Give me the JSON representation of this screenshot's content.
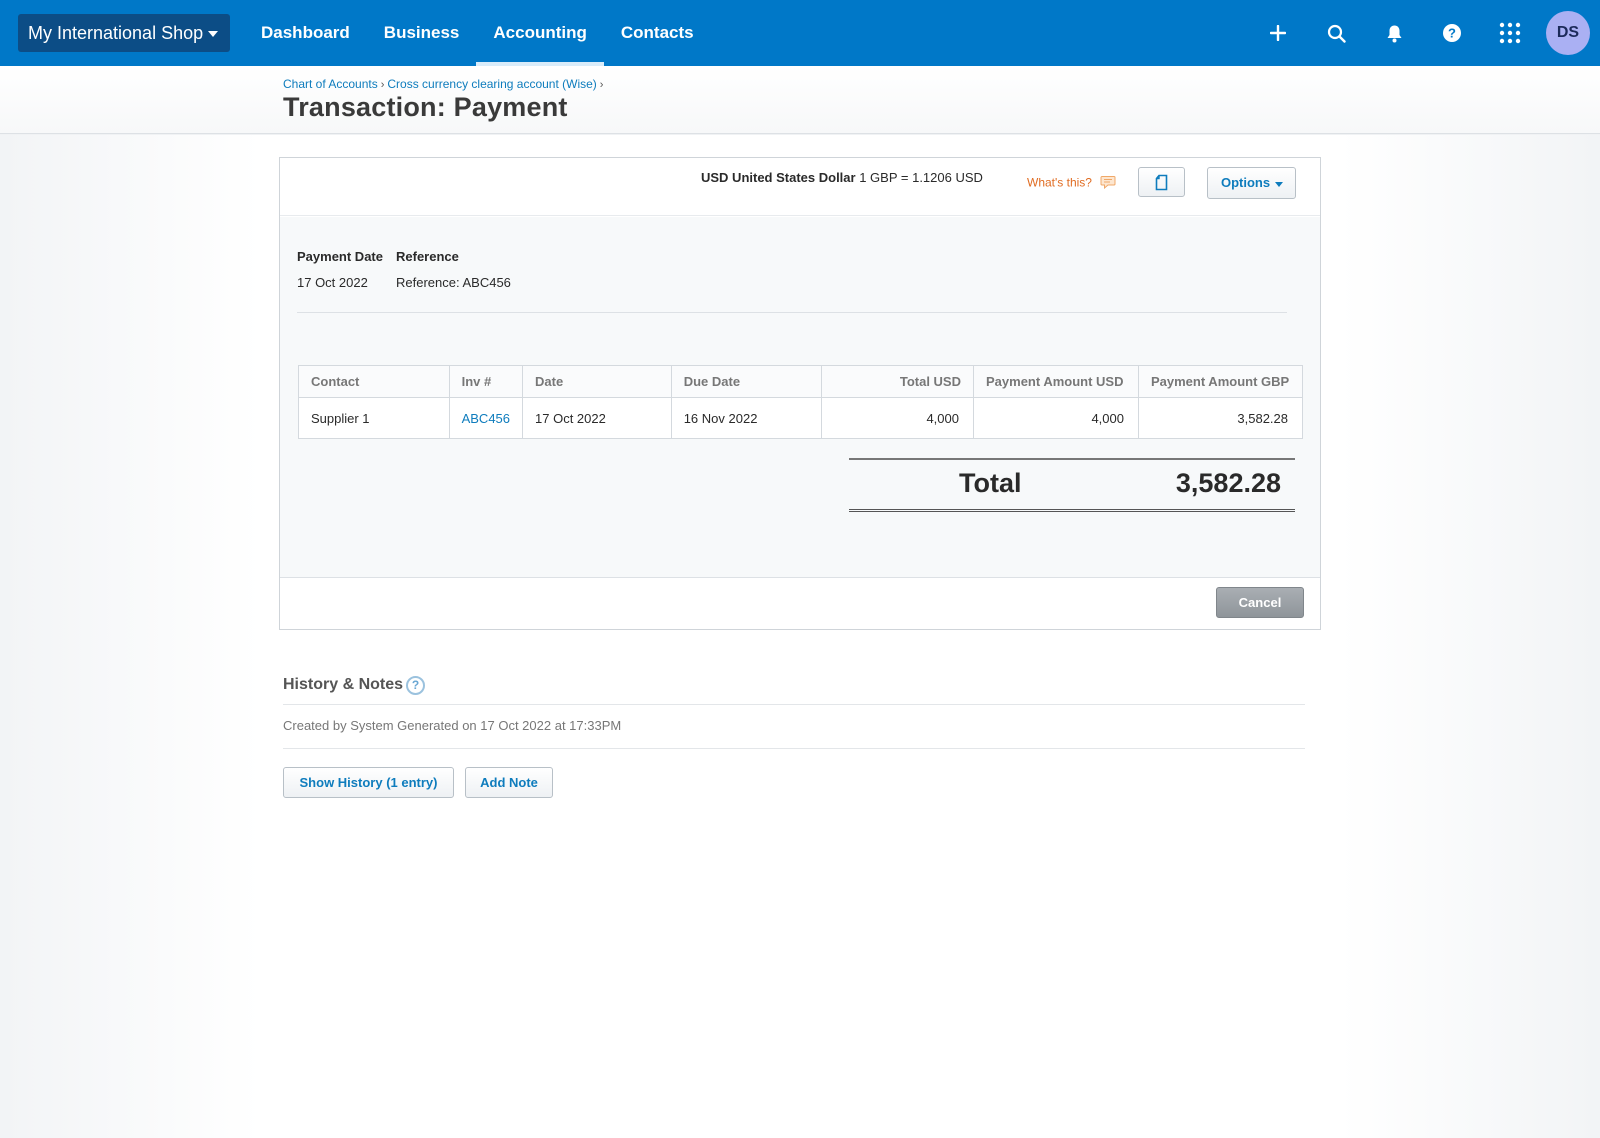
{
  "nav": {
    "org_name": "My International Shop",
    "links": [
      "Dashboard",
      "Business",
      "Accounting",
      "Contacts"
    ],
    "active": "Accounting",
    "icons": [
      "plus-icon",
      "search-icon",
      "bell-icon",
      "help-icon",
      "apps-grid-icon"
    ],
    "avatar_initials": "DS"
  },
  "breadcrumb": {
    "items": [
      "Chart of Accounts",
      "Cross currency clearing account (Wise)"
    ],
    "separator": "›"
  },
  "page_title": "Transaction: Payment",
  "currency": {
    "code_name": "USD United States Dollar",
    "rate": "1 GBP = 1.1206  USD",
    "whats_this": "What's this?"
  },
  "options_label": "Options",
  "payment": {
    "date_label": "Payment Date",
    "date_value": "17 Oct 2022",
    "reference_label": "Reference",
    "reference_value": "Reference: ABC456"
  },
  "table": {
    "headers": [
      "Contact",
      "Inv #",
      "Date",
      "Due Date",
      "Total USD",
      "Payment Amount USD",
      "Payment Amount GBP"
    ],
    "rows": [
      [
        "Supplier 1",
        "ABC456",
        "17 Oct 2022",
        "16 Nov 2022",
        "4,000",
        "4,000",
        "3,582.28"
      ]
    ]
  },
  "total": {
    "label": "Total",
    "value": "3,582.28"
  },
  "cancel_label": "Cancel",
  "history": {
    "title": "History & Notes",
    "help": "?",
    "entry": "Created by System Generated on 17 Oct 2022 at 17:33PM",
    "show_history_label": "Show History (1 entry)",
    "add_note_label": "Add Note"
  },
  "colors": {
    "nav_bg": "#0078c8",
    "org_switch_bg": "#0c4d86",
    "link": "#0e7cbd",
    "whats_this": "#e06c22",
    "avatar_bg": "#aab0f3"
  }
}
